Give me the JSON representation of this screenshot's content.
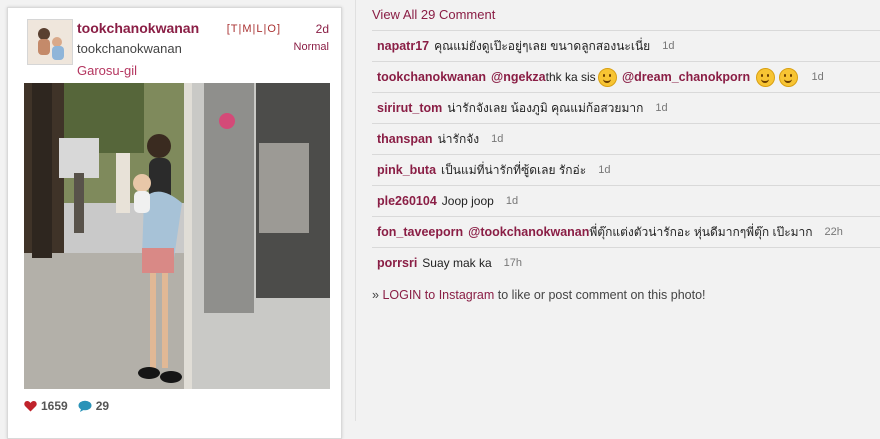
{
  "post": {
    "username": "tookchanokwanan",
    "full_name": "tookchanokwanan",
    "location": "Garosu-gil",
    "links": [
      "T",
      "M",
      "L",
      "O"
    ],
    "time_ago": "2d",
    "filter": "Normal",
    "likes": "1659",
    "comments_count": "29"
  },
  "comments_panel": {
    "view_all": "View All 29 Comment",
    "items": [
      {
        "user": "napatr17",
        "text": "คุณแม่ยังดูเป๊ะอยู่ๆเลย ขนาดลูกสองนะเนี่ย",
        "ago": "1d"
      },
      {
        "user": "tookchanokwanan",
        "mention1": "@ngekza",
        "text1": " thk ka sis",
        "mention2": "@dream_chanokporn",
        "ago": "1d"
      },
      {
        "user": "sirirut_tom",
        "text": "น่ารักจังเลย น้องภูมิ คุณแม่ก้อสวยมาก",
        "ago": "1d"
      },
      {
        "user": "thanspan",
        "text": "น่ารักจัง",
        "ago": "1d"
      },
      {
        "user": "pink_buta",
        "text": "เป็นแม่ที่น่ารักที่ซู้ดเลย รักอ่ะ",
        "ago": "1d"
      },
      {
        "user": "ple260104",
        "text": "Joop joop",
        "ago": "1d"
      },
      {
        "user": "fon_taveeporn",
        "mention1": "@tookchanokwanan",
        "text1": " พี่ตุ๊กแต่งตัวน่ารักอะ หุ่นดีมากๆพี่ตุ๊ก เป๊ะมาก",
        "ago": "22h"
      },
      {
        "user": "porrsri",
        "text": "Suay mak ka",
        "ago": "17h"
      }
    ],
    "login_prefix": "» ",
    "login_link": "LOGIN to Instagram",
    "login_suffix": " to like or post comment on this photo!"
  },
  "icons": {
    "heart": "heart-icon",
    "comment": "comment-bubble-icon"
  },
  "colors": {
    "accent": "#8a1e45",
    "heart": "#c0232b",
    "bubble": "#2a93b8"
  }
}
